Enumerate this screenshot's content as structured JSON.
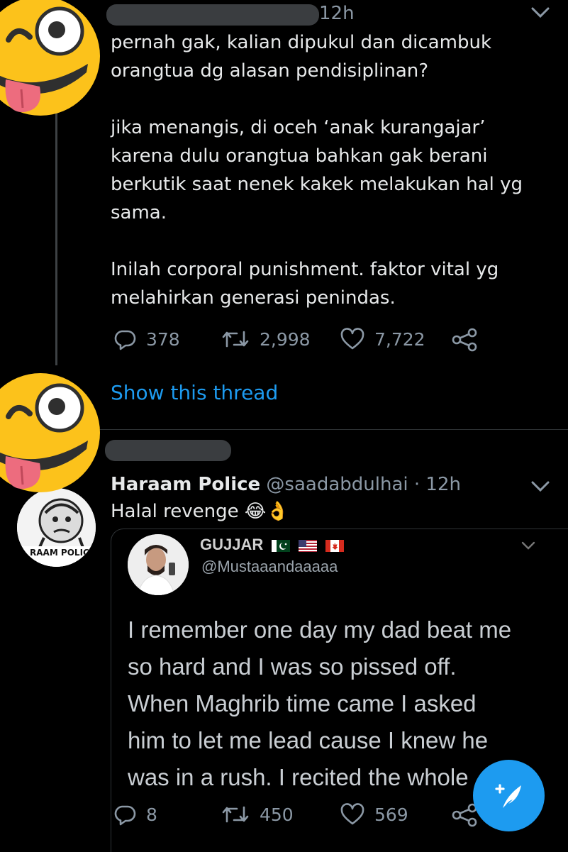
{
  "colors": {
    "background": "#000000",
    "text": "#e7e9ea",
    "muted": "#8b98a5",
    "accent": "#1d9bf0",
    "divider": "#2f3336"
  },
  "tweet1": {
    "time": "12h",
    "paragraphs": [
      "pernah gak, kalian dipukul dan dicambuk\norangtua dg alasan pendisiplinan?",
      "jika menangis, di oceh ‘anak kurangajar’\nkarena dulu orangtua bahkan gak berani\nberkutik saat nenek kakek melakukan hal yg\nsama.",
      "Inilah corporal punishment. faktor vital yg\nmelahirkan generasi penindas."
    ],
    "replies": "378",
    "retweets": "2,998",
    "likes": "7,722",
    "show_thread": "Show this thread"
  },
  "tweet2": {
    "name": "Haraam Police",
    "handle": "@saadabdulhai",
    "separator": "·",
    "time": "12h",
    "text": "Halal revenge 😂👌",
    "avatar_text": "RAAM POLIC",
    "replies": "8",
    "retweets": "450",
    "likes": "569"
  },
  "quoted": {
    "name": "GUJJAR",
    "handle": "@Mustaaandaaaaa",
    "text": "I remember one day my dad beat me\nso hard and I was so pissed off.\nWhen Maghrib time came I asked\nhim to let me lead cause I knew he\nwas in a rush. I recited the whole"
  },
  "icons": {
    "reply": "reply-icon",
    "retweet": "retweet-icon",
    "like": "heart-icon",
    "share": "share-icon",
    "more": "chevron-down-icon",
    "compose": "compose-tweet-icon",
    "sticker": "zany-face-emoji"
  }
}
